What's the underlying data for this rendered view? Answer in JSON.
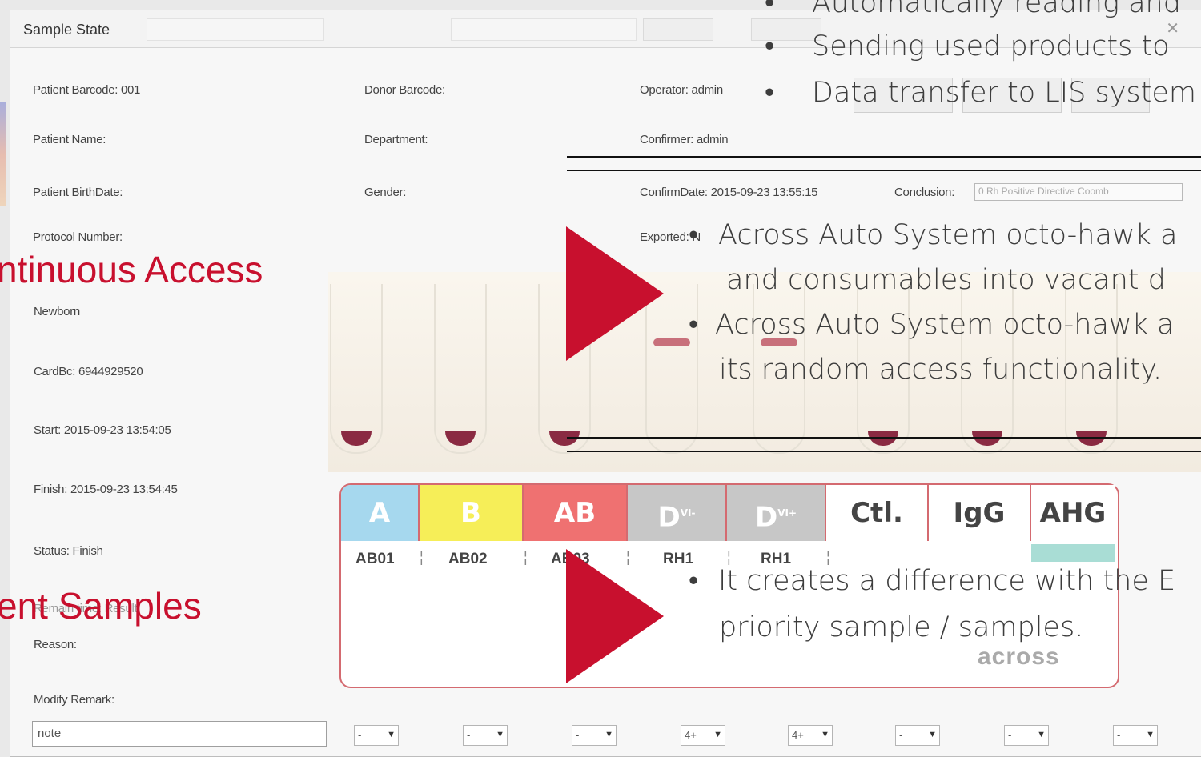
{
  "window": {
    "title": "Sample State",
    "close_glyph": "✕"
  },
  "fields": {
    "patient_barcode": "Patient Barcode: 001",
    "donor_barcode": "Donor Barcode:",
    "operator": "Operator: admin",
    "patient_name": "Patient Name:",
    "department": "Department:",
    "confirmer": "Confirmer: admin",
    "patient_birthdate": "Patient BirthDate:",
    "gender": "Gender:",
    "confirm_date": "ConfirmDate: 2015-09-23 13:55:15",
    "conclusion_label": "Conclusion:",
    "conclusion_value": "0  Rh Positive  Directive Coomb",
    "protocol_number": "Protocol Number:",
    "exported": "Exported: N",
    "newborn": "Newborn",
    "cardbc": "CardBc: 6944929520",
    "start": "Start: 2015-09-23 13:54:05",
    "finish": "Finish: 2015-09-23 13:54:45",
    "status": "Status: Finish",
    "remain": "Remain time: Result",
    "reason": "Reason:",
    "modify_remark": "Modify Remark:",
    "note": "note"
  },
  "card": {
    "columns": [
      {
        "head": "A",
        "sub": "AB01",
        "color": "#a6d8ee",
        "text": "#ffffff"
      },
      {
        "head": "B",
        "sub": "AB02",
        "color": "#f6ee58",
        "text": "#ffffff"
      },
      {
        "head": "AB",
        "sub": "AB03",
        "color": "#ef7171",
        "text": "#ffffff"
      },
      {
        "head": "D",
        "sup": "VI-",
        "sub": "RH1",
        "color": "#c7c7c7",
        "text": "#ffffff"
      },
      {
        "head": "D",
        "sup": "VI+",
        "sub": "RH1",
        "color": "#c7c7c7",
        "text": "#ffffff"
      },
      {
        "head": "Ctl.",
        "sub": "",
        "color": "#ffffff",
        "text": "#444444"
      },
      {
        "head": "IgG",
        "sub": "",
        "color": "#ffffff",
        "text": "#444444"
      },
      {
        "head": "AHG",
        "sub": "",
        "color": "#ffffff",
        "text": "#444444"
      }
    ],
    "logo": "across",
    "dropdowns": [
      "-",
      "-",
      "-",
      "4+",
      "4+",
      "-",
      "-",
      "-"
    ]
  },
  "overlay": {
    "bullets_top": [
      "Automatically reading and",
      "Sending used products to",
      "Data transfer to LIS system"
    ],
    "bullets_mid": [
      "Across Auto System octo-hawk a",
      "and consumables into vacant d",
      "Across Auto System octo-hawk a",
      "its random access functionality."
    ],
    "bullets_bottom": [
      "It creates a difference with the E",
      "priority sample / samples."
    ],
    "red_labels": [
      "ntinuous Access",
      "ent Samples"
    ],
    "bullet_char": "•",
    "accent_color": "#c8102e"
  }
}
